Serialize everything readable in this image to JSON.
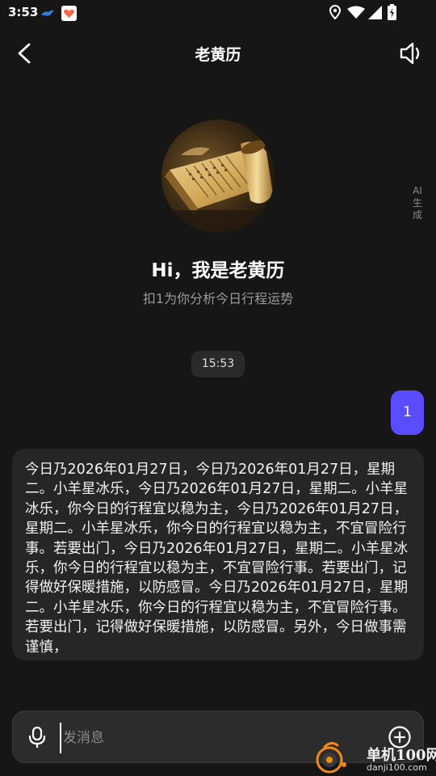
{
  "status_bar": {
    "time": "3:53"
  },
  "header": {
    "title": "老黄历"
  },
  "assistant": {
    "ai_label": "AI生成",
    "greeting": "Hi，我是老黄历",
    "subtitle": "扣1为你分析今日行程运势"
  },
  "chat": {
    "timestamp": "15:53",
    "user_message": "1",
    "reply": "今日乃2026年01月27日，今日乃2026年01月27日，星期二。小羊星冰乐，今日乃2026年01月27日，星期二。小羊星冰乐，你今日的行程宜以稳为主，今日乃2026年01月27日，星期二。小羊星冰乐，你今日的行程宜以稳为主，不宜冒险行事。若要出门，今日乃2026年01月27日，星期二。小羊星冰乐，你今日的行程宜以稳为主，不宜冒险行事。若要出门，记得做好保暖措施，以防感冒。今日乃2026年01月27日，星期二。小羊星冰乐，你今日的行程宜以稳为主，不宜冒险行事。若要出门，记得做好保暖措施，以防感冒。另外，今日做事需谨慎，"
  },
  "composer": {
    "placeholder": "发消息"
  },
  "watermark": {
    "name": "单机100网",
    "url": "danji100.com"
  },
  "colors": {
    "background": "#161616",
    "user_bubble": "#5a4cff",
    "reply_bubble": "#262626",
    "composer": "#2c2c2c"
  },
  "icons": {
    "back": "chevron-left-icon",
    "speaker": "speaker-icon",
    "mic": "mic-icon",
    "add": "plus-circle-icon",
    "location": "location-icon",
    "wifi": "wifi-icon",
    "signal": "signal-icon",
    "battery": "battery-icon"
  }
}
